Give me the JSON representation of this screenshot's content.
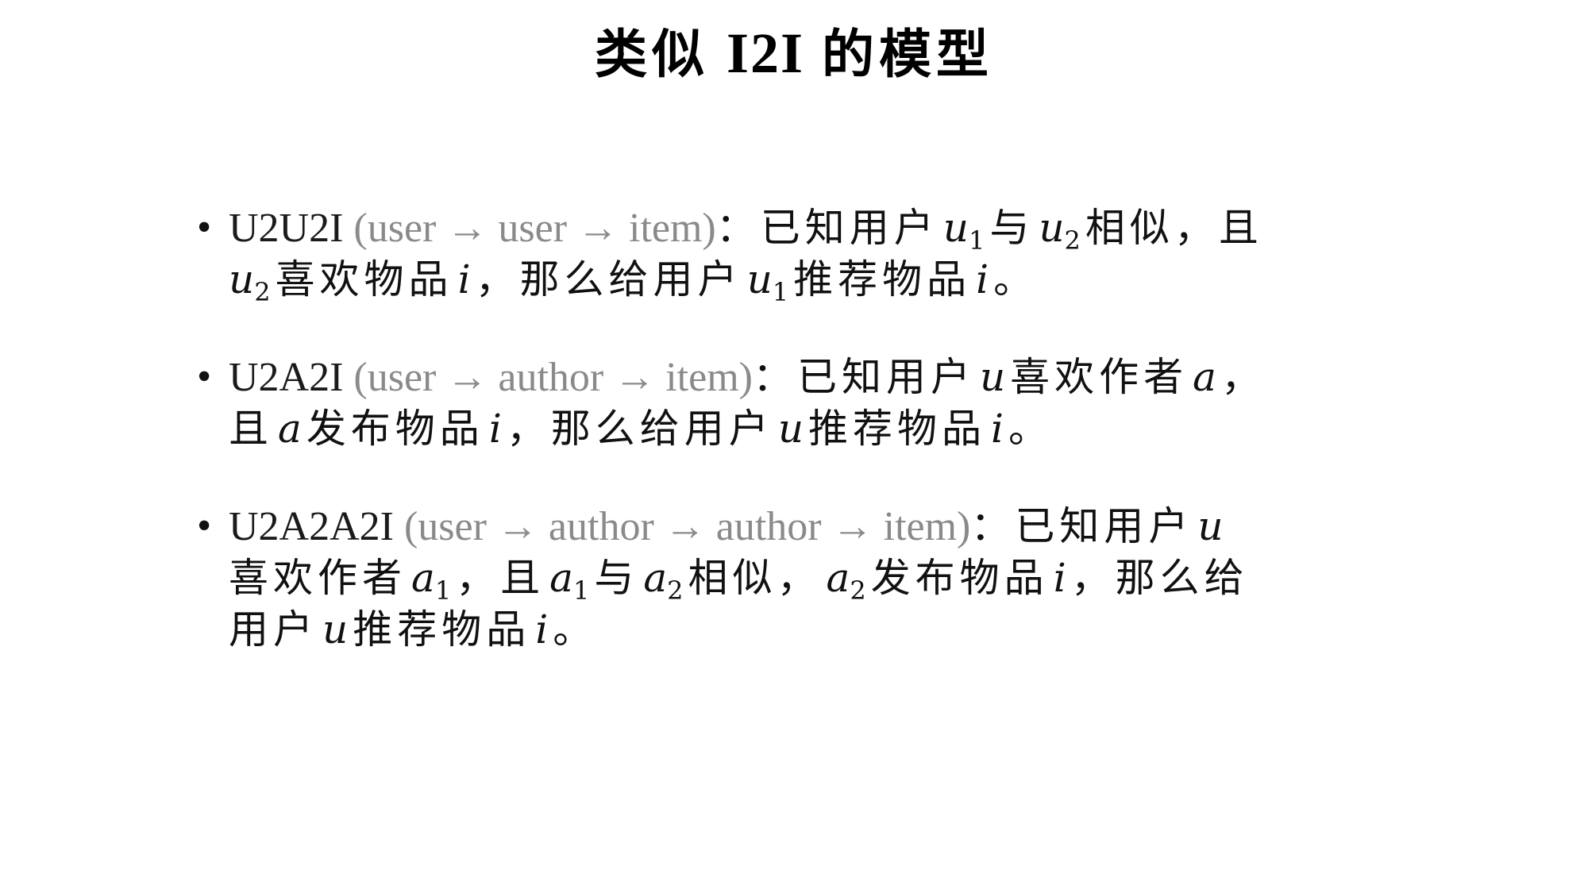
{
  "slide": {
    "title_prefix": "类似",
    "title_code": "I2I",
    "title_suffix": "的模型"
  },
  "bullets": [
    {
      "label": "U2U2I",
      "path": "(user → user → item)",
      "text": [
        "：已知用户",
        "u",
        "1",
        "与",
        "u",
        "2",
        "相似，且",
        "u",
        "2",
        "喜欢物品",
        "i",
        "，那么给用户",
        "u",
        "1",
        "推荐物品",
        "i",
        "。"
      ]
    },
    {
      "label": "U2A2I",
      "path": "(user → author → item)",
      "text": [
        "：已知用户",
        "u",
        "喜欢作者",
        "a",
        "，",
        "且",
        "a",
        "发布物品",
        "i",
        "，那么给用户",
        "u",
        "推荐物品",
        "i",
        "。"
      ]
    },
    {
      "label": "U2A2A2I",
      "path": "(user → author → author → item)",
      "text": [
        "：已知用户",
        "u",
        "喜欢作者",
        "a",
        "1",
        "，且",
        "a",
        "1",
        "与",
        "a",
        "2",
        "相似，",
        "a",
        "2",
        "发布物品",
        "i",
        "，那么给",
        "用户",
        "u",
        "推荐物品",
        "i",
        "。"
      ]
    }
  ]
}
